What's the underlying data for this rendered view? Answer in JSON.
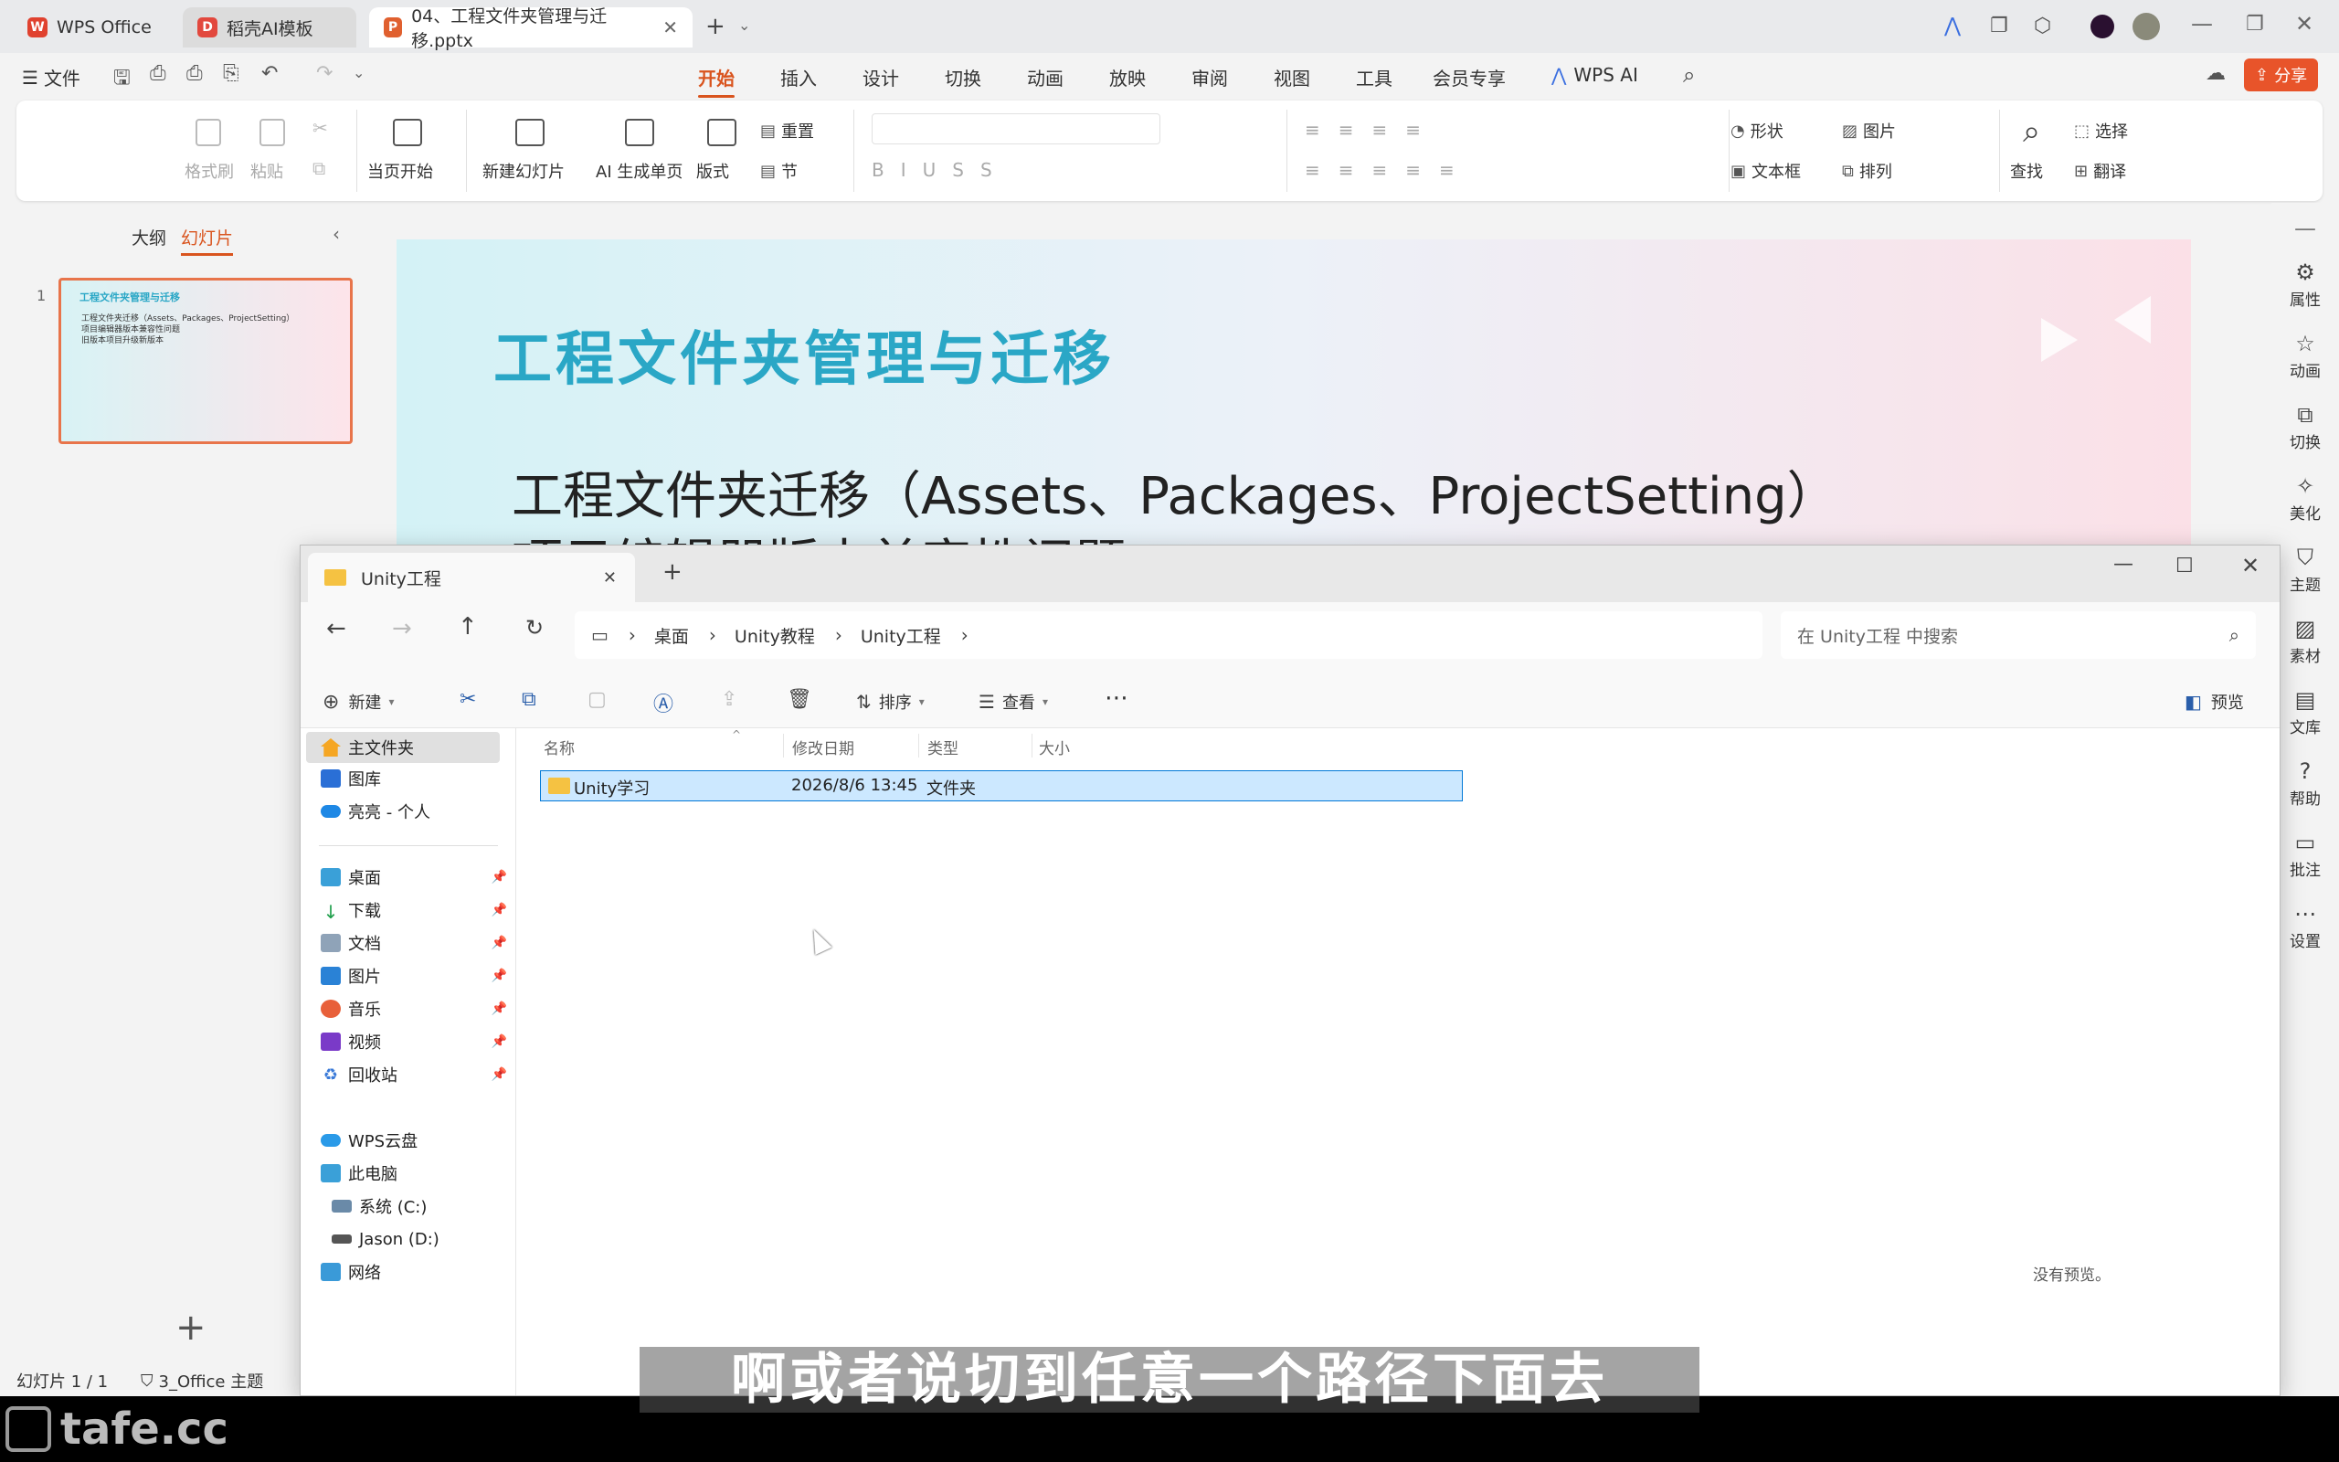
{
  "titlebar": {
    "tabs": [
      {
        "label": "WPS Office",
        "icon": "wps-logo-icon"
      },
      {
        "label": "稻壳AI模板",
        "icon": "docer-icon"
      },
      {
        "label": "04、工程文件夹管理与迁移.pptx",
        "icon": "pptx-icon"
      }
    ]
  },
  "menubar": {
    "file_label": "文件",
    "tabs": [
      "开始",
      "插入",
      "设计",
      "切换",
      "动画",
      "放映",
      "审阅",
      "视图",
      "工具",
      "会员专享"
    ],
    "wps_ai_label": "WPS AI",
    "share_label": "分享"
  },
  "ribbon": {
    "format_painter": "格式刷",
    "paste": "粘贴",
    "from_current": "当页开始",
    "new_slide": "新建幻灯片",
    "ai_single": "AI 生成单页",
    "layout": "版式",
    "reset": "重置",
    "section": "节",
    "shape": "形状",
    "picture": "图片",
    "textbox": "文本框",
    "arrange": "排列",
    "find": "查找",
    "select": "选择",
    "translate": "翻译"
  },
  "leftpanel": {
    "outline_tab": "大纲",
    "slides_tab": "幻灯片",
    "slide_number": "1",
    "thumb_title": "工程文件夹管理与迁移",
    "thumb_lines": [
      "工程文件夹迁移（Assets、Packages、ProjectSetting）",
      "项目编辑器版本兼容性问题",
      "旧版本项目升级新版本"
    ]
  },
  "slide": {
    "title": "工程文件夹管理与迁移",
    "bullet1": "工程文件夹迁移（Assets、Packages、ProjectSetting）",
    "bullet2": "项目编辑器版本兼容性问题"
  },
  "rightbar": [
    "属性",
    "动画",
    "切换",
    "美化",
    "主题",
    "素材",
    "文库",
    "帮助",
    "批注",
    "设置"
  ],
  "explorer": {
    "tab_title": "Unity工程",
    "breadcrumb": [
      "桌面",
      "Unity教程",
      "Unity工程"
    ],
    "search_placeholder": "在 Unity工程 中搜索",
    "cmd": {
      "new": "新建",
      "sort": "排序",
      "view": "查看",
      "preview": "预览"
    },
    "sidebar": {
      "home": "主文件夹",
      "gallery": "图库",
      "cloud": "亮亮 - 个人",
      "desktop": "桌面",
      "downloads": "下载",
      "documents": "文档",
      "pictures": "图片",
      "music": "音乐",
      "videos": "视频",
      "recycle": "回收站",
      "wpscloud": "WPS云盘",
      "thispc": "此电脑",
      "drive_c": "系统 (C:)",
      "drive_d": "Jason (D:)",
      "network": "网络"
    },
    "columns": {
      "name": "名称",
      "modified": "修改日期",
      "type": "类型",
      "size": "大小"
    },
    "rows": [
      {
        "name": "Unity学习",
        "modified": "2026/8/6 13:45",
        "type": "文件夹",
        "size": ""
      }
    ],
    "no_preview": "没有预览。"
  },
  "statusbar": {
    "slide_count": "幻灯片 1 / 1",
    "theme": "3_Office 主题"
  },
  "caption": "啊或者说切到任意一个路径下面去",
  "watermark": "tafe.cc",
  "colors": {
    "accent": "#d9541e",
    "slide_title": "#2aa7c6",
    "selection": "#cce8ff"
  }
}
